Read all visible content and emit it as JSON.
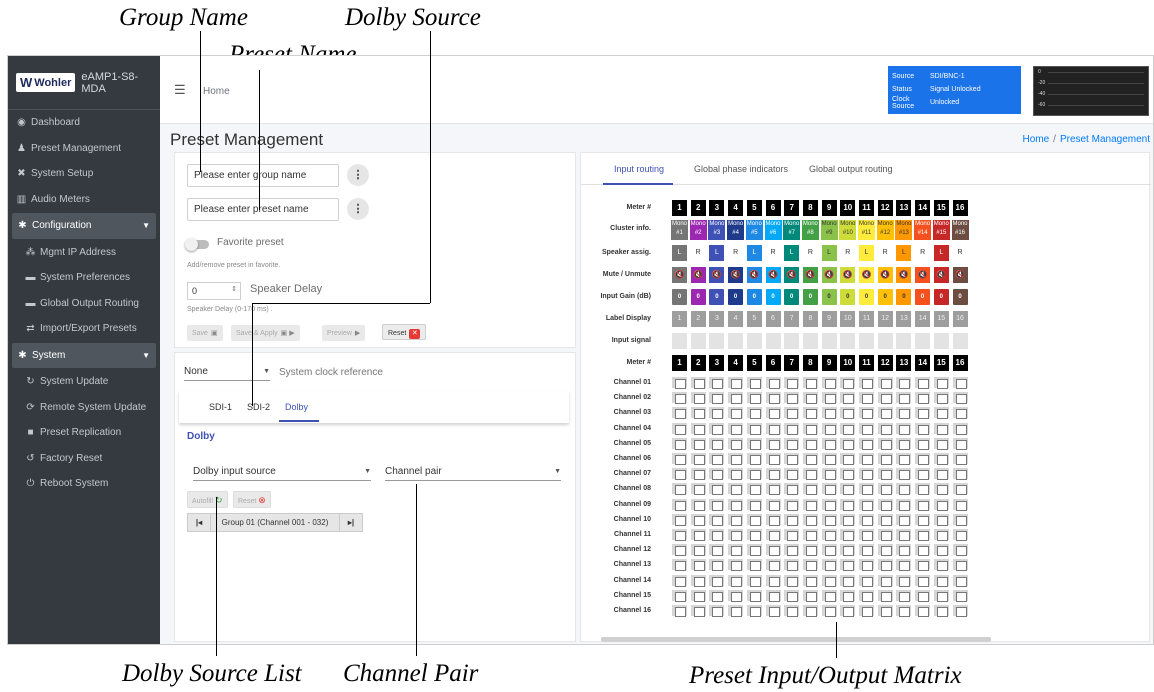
{
  "annotations": {
    "group_name": "Group Name",
    "dolby_source": "Dolby Source",
    "preset_name": "Preset Name",
    "dolby_source_list": "Dolby Source List",
    "channel_pair": "Channel Pair",
    "preset_matrix": "Preset Input/Output Matrix"
  },
  "brand": {
    "logo": "Wohler",
    "model": "eAMP1-S8-MDA"
  },
  "sidebar": {
    "items": [
      {
        "icon": "dashboard-icon",
        "glyph": "◉",
        "label": "Dashboard",
        "kind": "item"
      },
      {
        "icon": "user-cog-icon",
        "glyph": "♟",
        "label": "Preset Management",
        "kind": "item"
      },
      {
        "icon": "tools-icon",
        "glyph": "✖",
        "label": "System Setup",
        "kind": "item"
      },
      {
        "icon": "bar-chart-icon",
        "glyph": "▥",
        "label": "Audio Meters",
        "kind": "item"
      },
      {
        "icon": "gear-icon",
        "glyph": "✱",
        "label": "Configuration",
        "kind": "section"
      },
      {
        "icon": "network-icon",
        "glyph": "⁂",
        "label": "Mgmt IP Address",
        "kind": "sub"
      },
      {
        "icon": "preferences-icon",
        "glyph": "▬",
        "label": "System Preferences",
        "kind": "sub"
      },
      {
        "icon": "routing-icon",
        "glyph": "▬",
        "label": "Global Output Routing",
        "kind": "sub"
      },
      {
        "icon": "swap-icon",
        "glyph": "⇄",
        "label": "Import/Export Presets",
        "kind": "sub"
      },
      {
        "icon": "gears-icon",
        "glyph": "✱",
        "label": "System",
        "kind": "section"
      },
      {
        "icon": "sync-icon",
        "glyph": "↻",
        "label": "System Update",
        "kind": "sub"
      },
      {
        "icon": "remote-icon",
        "glyph": "⟳",
        "label": "Remote System Update",
        "kind": "sub"
      },
      {
        "icon": "copy-icon",
        "glyph": "■",
        "label": "Preset Replication",
        "kind": "sub"
      },
      {
        "icon": "undo-icon",
        "glyph": "↺",
        "label": "Factory Reset",
        "kind": "sub"
      },
      {
        "icon": "power-icon",
        "glyph": "⏻",
        "label": "Reboot System",
        "kind": "sub"
      }
    ]
  },
  "topbar": {
    "home": "Home",
    "status": [
      {
        "key": "Source",
        "value": "SDI/BNC-1"
      },
      {
        "key": "Status",
        "value": "Signal Unlocked"
      },
      {
        "key": "Clock Source",
        "value": "Unlocked"
      }
    ],
    "meter_ticks": [
      "0",
      "-20",
      "-40",
      "-60"
    ]
  },
  "page": {
    "title": "Preset Management",
    "breadcrumb": [
      "Home",
      "Preset Management"
    ]
  },
  "preset_form": {
    "group_placeholder": "Please enter group name",
    "preset_placeholder": "Please enter preset name",
    "favorite_label": "Favorite preset",
    "favorite_hint": "Add/remove preset in favorite.",
    "delay_value": "0",
    "delay_label": "Speaker Delay",
    "delay_hint": "Speaker Delay (0-170 ms) .",
    "save": "Save",
    "save_apply": "Save & Apply",
    "preview": "Preview",
    "reset": "Reset"
  },
  "source_panel": {
    "clock_value": "None",
    "clock_label": "System clock reference",
    "tabs": [
      "SDI-1",
      "SDI-2",
      "Dolby"
    ],
    "dolby_heading": "Dolby",
    "dolby_input_source": "Dolby input source",
    "channel_pair": "Channel pair",
    "autofill": "Autofill",
    "reset": "Reset",
    "pager_label": "Group 01 (Channel 001 - 032)"
  },
  "matrix": {
    "tabs": [
      "Input routing",
      "Global phase indicators",
      "Global output routing"
    ],
    "row_labels": {
      "meter": "Meter #",
      "cluster": "Cluster info.",
      "speaker": "Speaker assig.",
      "mute": "Mute / Unmute",
      "gain": "Input Gain (dB)",
      "label": "Label Display",
      "signal": "Input signal"
    },
    "meters": [
      "1",
      "2",
      "3",
      "4",
      "5",
      "6",
      "7",
      "8",
      "9",
      "10",
      "11",
      "12",
      "13",
      "14",
      "15",
      "16"
    ],
    "cluster_type": "Mono",
    "cluster_ids": [
      "#1",
      "#2",
      "#3",
      "#4",
      "#5",
      "#6",
      "#7",
      "#8",
      "#9",
      "#10",
      "#11",
      "#12",
      "#13",
      "#14",
      "#15",
      "#16"
    ],
    "speakers": [
      "L",
      "R",
      "L",
      "R",
      "L",
      "R",
      "L",
      "R",
      "L",
      "R",
      "L",
      "R",
      "L",
      "R",
      "L",
      "R"
    ],
    "gains": [
      "0",
      "0",
      "0",
      "0",
      "0",
      "0",
      "0",
      "0",
      "0",
      "0",
      "0",
      "0",
      "0",
      "0",
      "0",
      "0"
    ],
    "labels": [
      "1",
      "2",
      "3",
      "4",
      "5",
      "6",
      "7",
      "8",
      "9",
      "10",
      "11",
      "12",
      "13",
      "14",
      "15",
      "16"
    ],
    "colors": [
      "#757575",
      "#9c27b0",
      "#3f51b5",
      "#1e3a8a",
      "#1e88e5",
      "#03a9f4",
      "#00897b",
      "#43a047",
      "#8bc34a",
      "#cddc39",
      "#ffeb3b",
      "#ffc107",
      "#ff9800",
      "#f4511e",
      "#c62828",
      "#6d4c41"
    ],
    "channels": [
      "Channel 01",
      "Channel 02",
      "Channel 03",
      "Channel 04",
      "Channel 05",
      "Channel 06",
      "Channel 07",
      "Channel 08",
      "Channel 09",
      "Channel 10",
      "Channel 11",
      "Channel 12",
      "Channel 13",
      "Channel 14",
      "Channel 15",
      "Channel 16"
    ]
  }
}
